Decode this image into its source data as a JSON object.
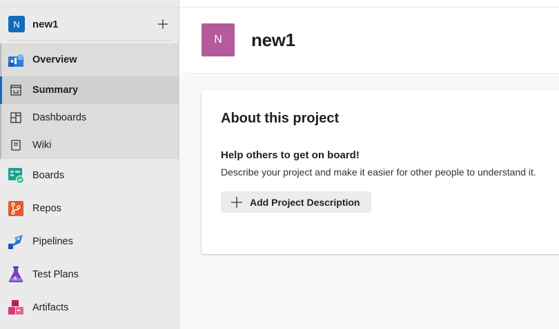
{
  "project": {
    "initial": "N",
    "name": "new1"
  },
  "sidebar": {
    "items": [
      {
        "label": "Overview",
        "icon": "overview-icon"
      },
      {
        "label": "Summary",
        "icon": "summary-icon"
      },
      {
        "label": "Dashboards",
        "icon": "dashboards-icon"
      },
      {
        "label": "Wiki",
        "icon": "wiki-icon"
      },
      {
        "label": "Boards",
        "icon": "boards-icon"
      },
      {
        "label": "Repos",
        "icon": "repos-icon"
      },
      {
        "label": "Pipelines",
        "icon": "pipelines-icon"
      },
      {
        "label": "Test Plans",
        "icon": "test-plans-icon"
      },
      {
        "label": "Artifacts",
        "icon": "artifacts-icon"
      }
    ]
  },
  "main": {
    "avatar_initial": "N",
    "title": "new1",
    "about": {
      "title": "About this project",
      "subtitle": "Help others to get on board!",
      "description": "Describe your project and make it easier for other people to understand it.",
      "button_label": "Add Project Description"
    }
  },
  "colors": {
    "accent": "#0f6cbd",
    "project_avatar": "#b45b9b"
  }
}
